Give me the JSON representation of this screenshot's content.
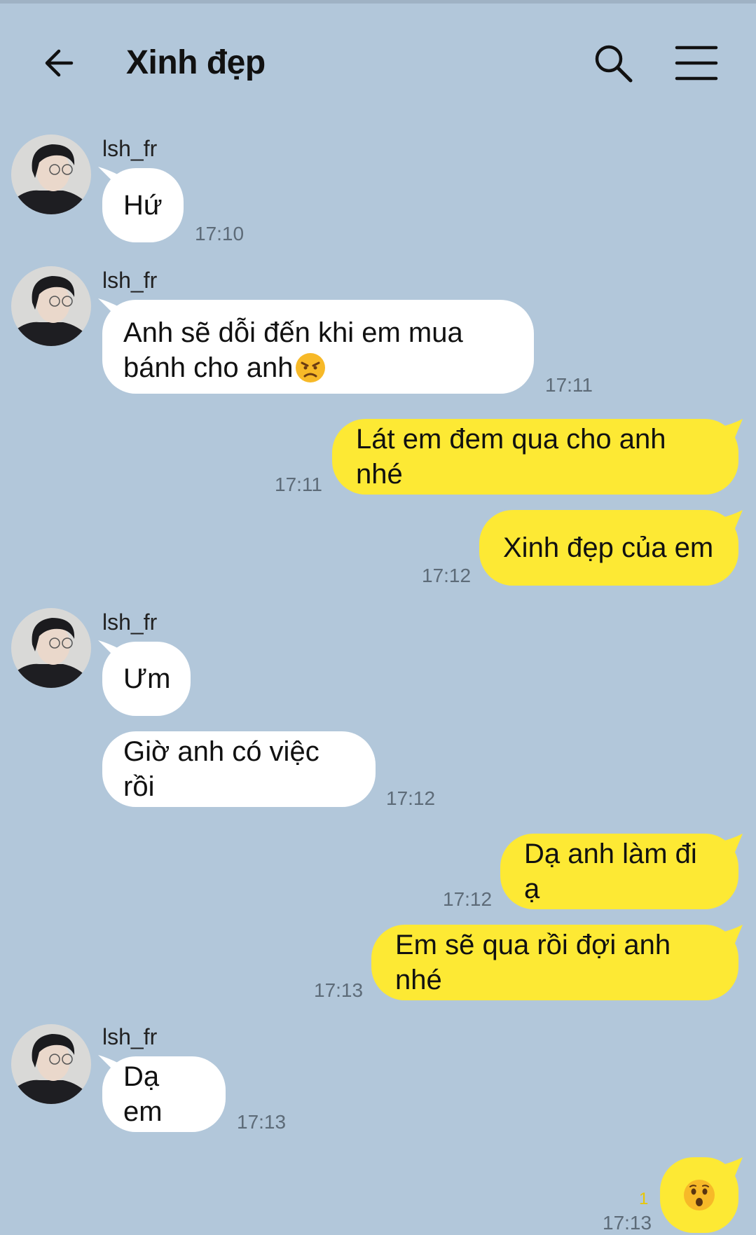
{
  "chat": {
    "title": "Xinh đẹp"
  },
  "icons": {
    "back": "arrow-left-icon",
    "search": "search-icon",
    "menu": "hamburger-menu-icon",
    "emoji_angry": "angry-face-emoji",
    "emoji_surprised": "surprised-face-emoji"
  },
  "colors": {
    "background": "#b2c7da",
    "incoming_bubble": "#ffffff",
    "outgoing_bubble": "#fde934"
  },
  "messages": [
    {
      "sender": "lsh_fr",
      "text": "Hứ",
      "time": "17:10"
    },
    {
      "sender": "lsh_fr",
      "text_line1": "Anh sẽ dỗi đến khi em mua",
      "text_line2": "bánh cho anh",
      "time": "17:11"
    },
    {
      "text": "Lát em đem qua cho anh nhé",
      "time": "17:11"
    },
    {
      "text": "Xinh đẹp của em",
      "time": "17:12"
    },
    {
      "sender": "lsh_fr",
      "text": "Ưm"
    },
    {
      "text": "Giờ anh có việc rồi",
      "time": "17:12"
    },
    {
      "text": "Dạ anh làm đi ạ",
      "time": "17:12"
    },
    {
      "text": "Em sẽ qua rồi đợi anh nhé",
      "time": "17:13"
    },
    {
      "sender": "lsh_fr",
      "text": "Dạ em",
      "time": "17:13"
    },
    {
      "unread": "1",
      "time": "17:13"
    }
  ]
}
